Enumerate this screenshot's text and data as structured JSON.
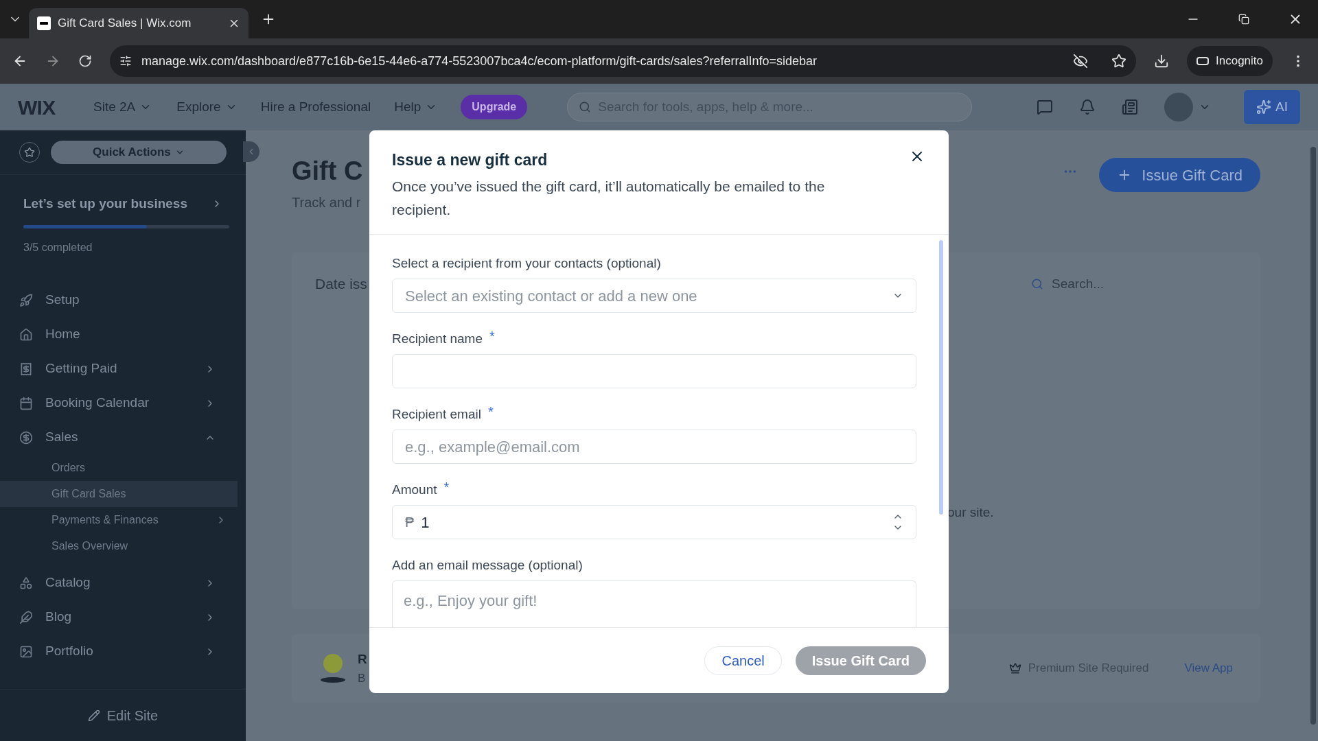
{
  "browser": {
    "tab_title": "Gift Card Sales | Wix.com",
    "url": "manage.wix.com/dashboard/e877c16b-6e15-44e6-a774-5523007bca4c/ecom-platform/gift-cards/sales?referralInfo=sidebar",
    "profile": "Incognito"
  },
  "topbar": {
    "logo": "WIX",
    "site": "Site 2A",
    "menus": [
      "Explore",
      "Hire a Professional",
      "Help"
    ],
    "upgrade": "Upgrade",
    "search_placeholder": "Search for tools, apps, help & more...",
    "ai": "AI"
  },
  "sidebar": {
    "quick_actions": "Quick Actions",
    "setup_title": "Let’s set up your business",
    "level": 0.6,
    "progress_text": "3/5 completed",
    "items": [
      {
        "label": "Setup",
        "kind": "link"
      },
      {
        "label": "Home",
        "kind": "link"
      },
      {
        "label": "Getting Paid",
        "kind": "menu",
        "expanded": false
      },
      {
        "label": "Booking Calendar",
        "kind": "menu",
        "expanded": false
      },
      {
        "label": "Sales",
        "kind": "menu",
        "expanded": true,
        "children": [
          {
            "label": "Orders",
            "selected": false,
            "submenu": false
          },
          {
            "label": "Gift Card Sales",
            "selected": true,
            "submenu": false
          },
          {
            "label": "Payments & Finances",
            "selected": false,
            "submenu": true
          },
          {
            "label": "Sales Overview",
            "selected": false,
            "submenu": false
          }
        ]
      },
      {
        "label": "Catalog",
        "kind": "menu",
        "expanded": false
      },
      {
        "label": "Blog",
        "kind": "menu",
        "expanded": false
      },
      {
        "label": "Portfolio",
        "kind": "menu",
        "expanded": false
      }
    ],
    "edit_site": "Edit Site"
  },
  "page": {
    "title": "Gift C",
    "subtitle": "Track and r",
    "issue_button": "Issue Gift Card",
    "column_1": "Date iss",
    "search_placeholder": "Search...",
    "empty_text": "our site.",
    "app_card": {
      "title": "R",
      "subtitle": "B",
      "premium": "Premium Site Required",
      "link": "View App"
    }
  },
  "dialog": {
    "title": "Issue a new gift card",
    "description": "Once you’ve issued the gift card, it’ll automatically be emailed to the recipient.",
    "fields": [
      {
        "kind": "select",
        "label": "Select a recipient from your contacts (optional)",
        "placeholder": "Select an existing contact or add a new one"
      },
      {
        "kind": "text",
        "label": "Recipient name",
        "required_mark": "*"
      },
      {
        "kind": "text",
        "label": "Recipient email",
        "required_mark": "*",
        "placeholder": "e.g., example@email.com"
      },
      {
        "kind": "number",
        "label": "Amount",
        "required_mark": "*",
        "currency": "₱",
        "value": "1"
      },
      {
        "kind": "textarea",
        "label": "Add an email message (optional)",
        "placeholder": "e.g., Enjoy your gift!"
      }
    ],
    "cancel": "Cancel",
    "submit": {
      "label": "Issue Gift Card",
      "disabled": true
    }
  }
}
